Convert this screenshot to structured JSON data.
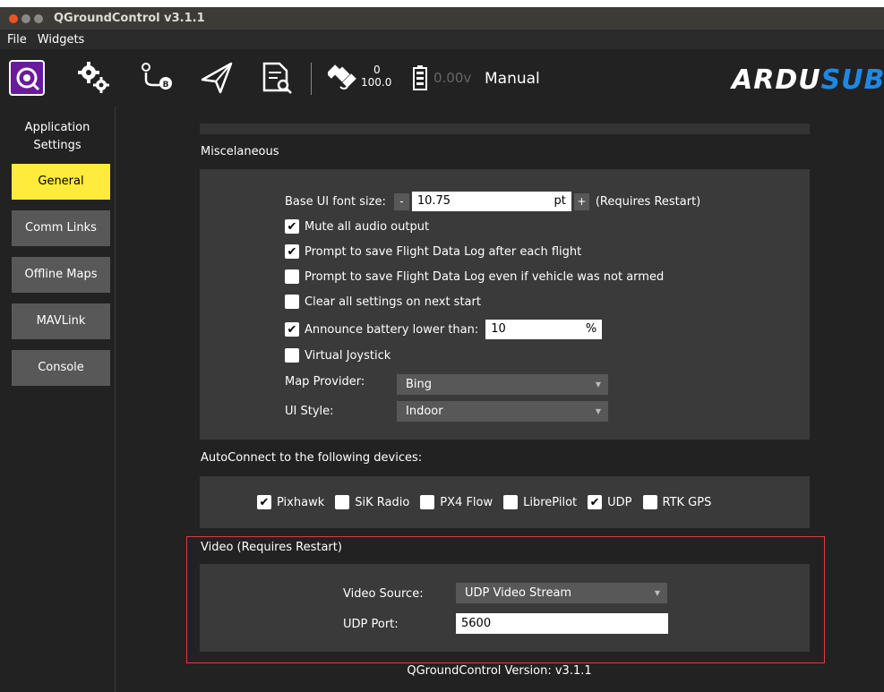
{
  "window": {
    "title": "QGroundControl v3.1.1"
  },
  "menu": {
    "file": "File",
    "widgets": "Widgets"
  },
  "toolbar": {
    "gps_count": "0",
    "gps_hdop": "100.0",
    "battery": "0.00v",
    "flight_mode": "Manual",
    "logo_part1": "ARDU",
    "logo_part2": "SUB",
    "icons": [
      "app-logo-icon",
      "settings-gears-icon",
      "plan-route-icon",
      "fly-paper-plane-icon",
      "analyze-document-icon",
      "gps-satellite-icon",
      "battery-icon"
    ]
  },
  "sidebar": {
    "header": "Application Settings",
    "items": [
      {
        "label": "General",
        "active": true
      },
      {
        "label": "Comm Links",
        "active": false
      },
      {
        "label": "Offline Maps",
        "active": false
      },
      {
        "label": "MAVLink",
        "active": false
      },
      {
        "label": "Console",
        "active": false
      }
    ]
  },
  "misc": {
    "title": "Miscelaneous",
    "font_size_label": "Base UI font size:",
    "font_minus": "-",
    "font_value": "10.75",
    "font_unit": "pt",
    "font_plus": "+",
    "font_note": "(Requires Restart)",
    "checkboxes": [
      {
        "label": "Mute all audio output",
        "checked": true
      },
      {
        "label": "Prompt to save Flight Data Log after each flight",
        "checked": true
      },
      {
        "label": "Prompt to save Flight Data Log even if vehicle was not armed",
        "checked": false
      },
      {
        "label": "Clear all settings on next start",
        "checked": false
      }
    ],
    "battery_label": "Announce battery lower than:",
    "battery_checked": true,
    "battery_value": "10",
    "battery_unit": "%",
    "virtual_joystick": "Virtual Joystick",
    "virtual_joystick_checked": false,
    "map_provider_label": "Map Provider:",
    "map_provider_value": "Bing",
    "ui_style_label": "UI Style:",
    "ui_style_value": "Indoor"
  },
  "autoconnect": {
    "title": "AutoConnect to the following devices:",
    "devices": [
      {
        "label": "Pixhawk",
        "checked": true
      },
      {
        "label": "SiK Radio",
        "checked": false
      },
      {
        "label": "PX4 Flow",
        "checked": false
      },
      {
        "label": "LibrePilot",
        "checked": false
      },
      {
        "label": "UDP",
        "checked": true
      },
      {
        "label": "RTK GPS",
        "checked": false
      }
    ]
  },
  "video": {
    "title": "Video (Requires Restart)",
    "source_label": "Video Source:",
    "source_value": "UDP Video Stream",
    "port_label": "UDP Port:",
    "port_value": "5600"
  },
  "footer": {
    "version": "QGroundControl Version: v3.1.1"
  },
  "colors": {
    "accent": "#ffeb3b",
    "highlight": "#e53935",
    "panel": "#3a3a3a"
  }
}
